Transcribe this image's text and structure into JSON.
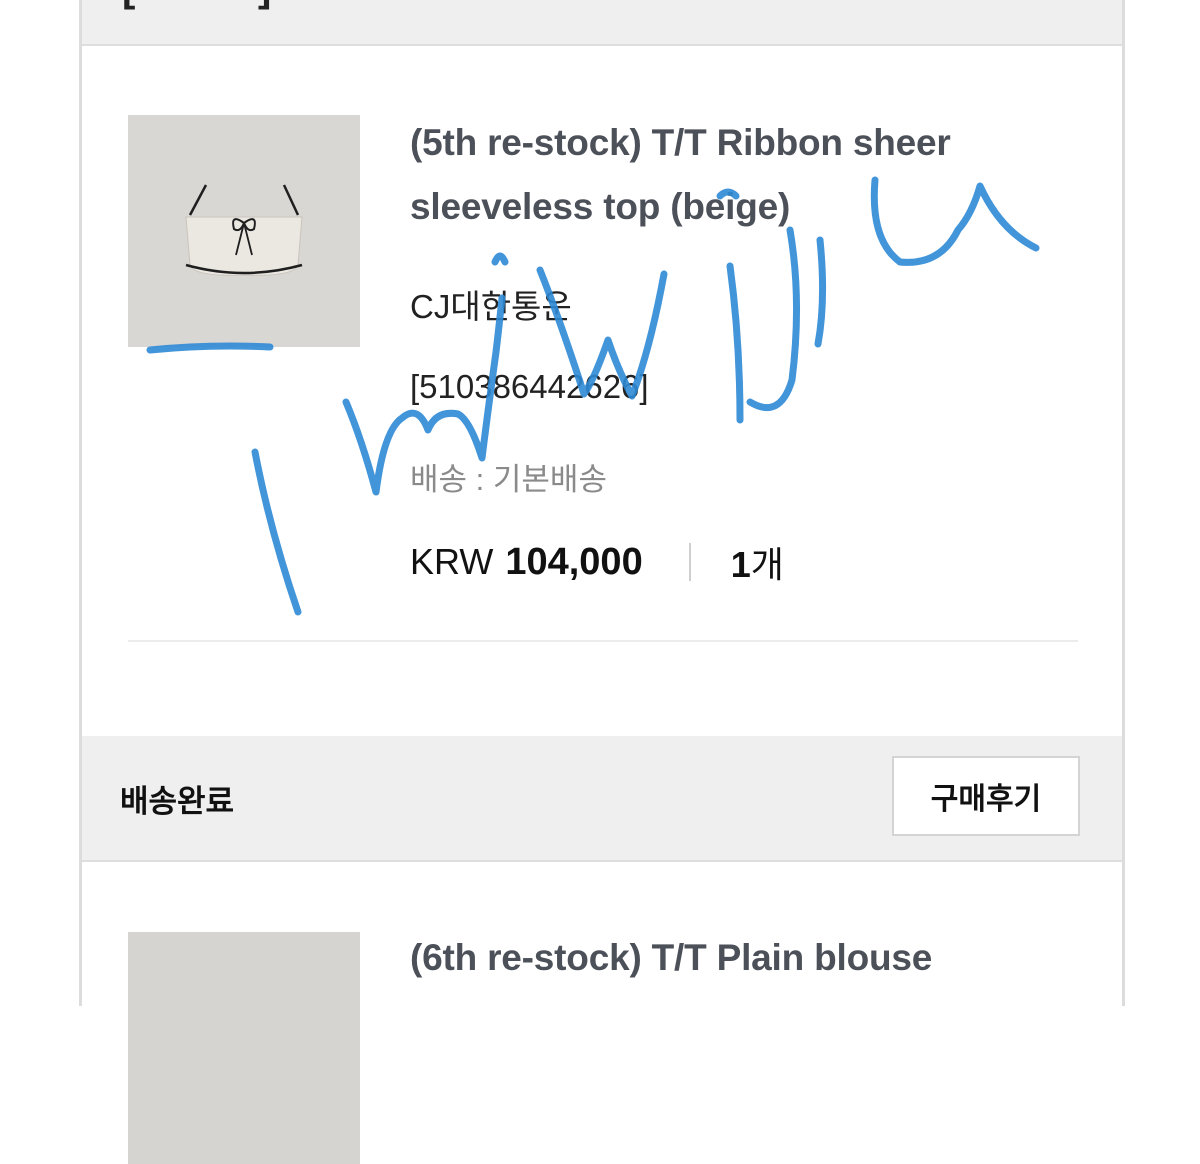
{
  "order_header": {
    "bracket_open": "[",
    "bracket_close": "]"
  },
  "products": [
    {
      "title": "(5th re-stock) T/T Ribbon sheer sleeveless top (beige)",
      "carrier": "CJ대한통운",
      "tracking": "[510386442626]",
      "shipping": "배송 : 기본배송",
      "currency": "KRW",
      "price": "104,000",
      "quantity_number": "1",
      "quantity_unit": "개"
    },
    {
      "title": "(6th re-stock) T/T Plain blouse"
    }
  ],
  "status": {
    "label": "배송완료",
    "review_button": "구매후기"
  },
  "colors": {
    "title_gray": "#4c5058",
    "header_bg": "#efefef",
    "scribble_blue": "#2f8ad6"
  }
}
